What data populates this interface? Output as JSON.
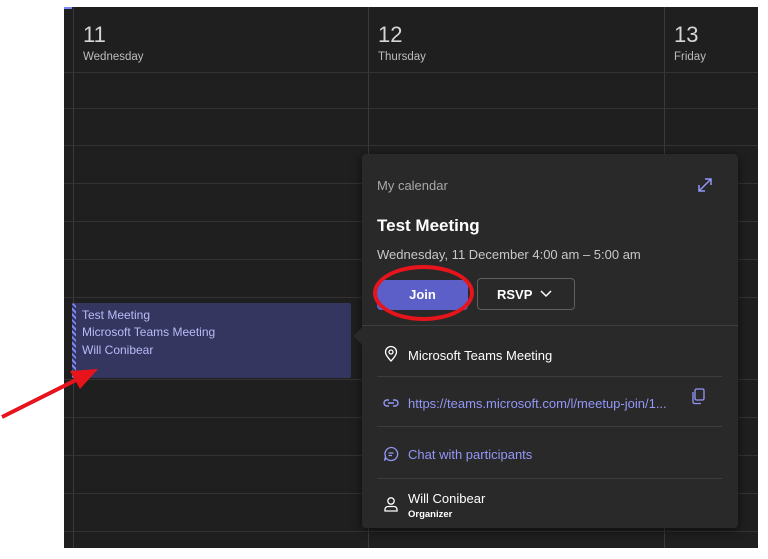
{
  "days": [
    {
      "number": "11",
      "name": "Wednesday"
    },
    {
      "number": "12",
      "name": "Thursday"
    },
    {
      "number": "13",
      "name": "Friday"
    }
  ],
  "event": {
    "title": "Test Meeting",
    "location": "Microsoft Teams Meeting",
    "organizer": "Will Conibear"
  },
  "popup": {
    "calendar_name": "My calendar",
    "title": "Test Meeting",
    "time": "Wednesday, 11 December 4:00 am – 5:00 am",
    "join_label": "Join",
    "rsvp_label": "RSVP",
    "location": "Microsoft Teams Meeting",
    "link": "https://teams.microsoft.com/l/meetup-join/1...",
    "chat_label": "Chat with participants",
    "organizer_name": "Will Conibear",
    "organizer_role": "Organizer"
  },
  "icons": {
    "expand": "expand-icon",
    "location": "location-pin-icon",
    "link": "link-icon",
    "copy": "copy-icon",
    "chat": "chat-icon",
    "person": "person-icon",
    "chevron": "chevron-down-icon"
  },
  "colors": {
    "accent": "#5b5fc7",
    "accent_light": "#9397f7",
    "annotation": "#e8141b",
    "background": "#1f1f1f"
  }
}
